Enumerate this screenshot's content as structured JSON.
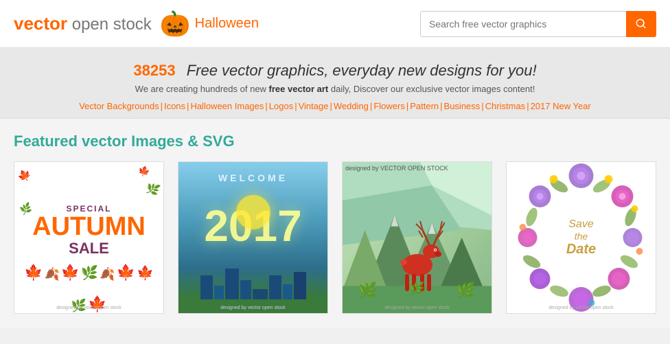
{
  "header": {
    "logo_vector": "vector",
    "logo_rest": " open stock",
    "halloween_label": "Halloween",
    "search_placeholder": "Search free vector graphics"
  },
  "hero": {
    "count": "38253",
    "tagline": "Free vector graphics, everyday new designs for you!",
    "subtitle_1": "We are creating hundreds of new ",
    "subtitle_bold": "free vector art",
    "subtitle_2": " daily, Discover our ",
    "subtitle_3": "exclusive vector images content!",
    "nav_links": [
      "Vector Backgrounds",
      "Icons",
      "Halloween Images",
      "Logos",
      "Vintage",
      "Wedding",
      "Flowers",
      "Pattern",
      "Business",
      "Christmas",
      "2017 New Year"
    ]
  },
  "main": {
    "section_title_1": "Featured vector ",
    "section_title_2": "Images & SVG",
    "cards": [
      {
        "id": "autumn-sale",
        "title": "Special Autumn Sale",
        "watermark": "designed by vector open stock"
      },
      {
        "id": "welcome-2017",
        "title": "Welcome 2017",
        "watermark": "designed by vector open stock"
      },
      {
        "id": "deer",
        "title": "Deer Vector",
        "watermark": "designed by vector open stock"
      },
      {
        "id": "save-the-date",
        "title": "Save the Date",
        "watermark": "designed by vector open stock"
      }
    ]
  },
  "icons": {
    "search": "🔍",
    "pumpkin": "🎃"
  }
}
